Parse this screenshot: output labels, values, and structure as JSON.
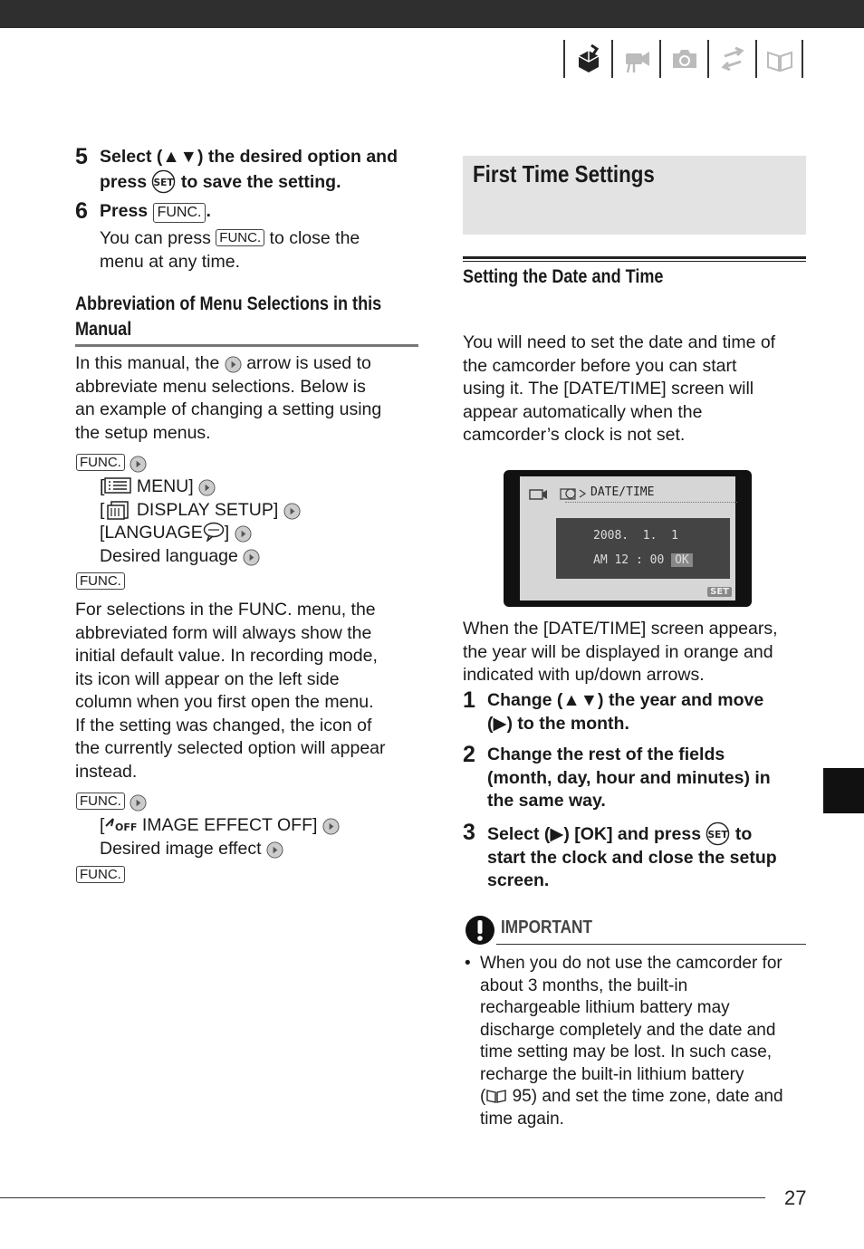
{
  "page": {
    "number": "27"
  },
  "left": {
    "step5": {
      "num": "5",
      "line1_pre": "Select (",
      "line1_arrows": "▲▼",
      "line1_post": ") the desired option and",
      "line2_pre": "press",
      "line2_post": "to save the setting."
    },
    "step6": {
      "num": "6",
      "label": "Press",
      "key": "FUNC.",
      "period": ".",
      "note_pre": "You can press",
      "note_key": "FUNC.",
      "note_post": "to close the",
      "note_line2": "menu at any time."
    },
    "abbrev": {
      "title_line1": "Abbreviation of Menu Selections in this",
      "title_line2": "Manual",
      "para1_l1_pre": "In this manual, the",
      "para1_l1_post": "arrow is used to",
      "para1_l2": "abbreviate menu selections. Below is",
      "para1_l3": "an example of changing a setting using",
      "para1_l4": "the setup menus.",
      "ex1_key1": "FUNC.",
      "ex1_menu": "MENU]",
      "ex1_display": "DISPLAY SETUP]",
      "ex1_language": "[LANGUAGE",
      "ex1_language_end": "]",
      "ex1_desired": "Desired language",
      "ex1_key2": "FUNC.",
      "para2_lines": [
        "For selections in the FUNC. menu, the",
        "abbreviated form will always show the",
        "initial default value. In recording mode,",
        "its icon will appear on the left side",
        "column when you first open the menu.",
        "If the setting was changed, the icon of",
        "the currently selected option will appear",
        "instead."
      ],
      "ex2_key1": "FUNC.",
      "ex2_effect": "IMAGE EFFECT OFF]",
      "ex2_desired": "Desired image effect",
      "ex2_key2": "FUNC."
    }
  },
  "right": {
    "section_title": "First Time Settings",
    "subsection_title": "Setting the Date and Time",
    "intro_lines": [
      "You will need to set the date and time of",
      "the camcorder before you can start",
      "using it. The [DATE/TIME] screen will",
      "appear automatically when the",
      "camcorder’s clock is not set."
    ],
    "lcd": {
      "title": "DATE/TIME",
      "date": "2008.  1.  1",
      "time_prefix": "AM 12 : 00",
      "ok": "OK",
      "set": "SET"
    },
    "after_lines": [
      "When the [DATE/TIME] screen appears,",
      "the year will be displayed in orange and",
      "indicated with up/down arrows."
    ],
    "step1": {
      "num": "1",
      "l1_pre": "Change (",
      "l1_arrows": "▲▼",
      "l1_post": ") the year and move",
      "l2": "(▶) to the month."
    },
    "step2": {
      "num": "2",
      "lines": [
        "Change the rest of the fields",
        "(month, day, hour and minutes) in",
        "the same way."
      ]
    },
    "step3": {
      "num": "3",
      "l1_pre": "Select (▶) [OK] and press",
      "l1_post": "to",
      "l2": "start the clock and close the setup",
      "l3": "screen."
    },
    "important": {
      "label": "IMPORTANT",
      "bullet": "•",
      "lines": [
        "When you do not use the camcorder for",
        "about 3 months, the built-in",
        "rechargeable lithium battery may",
        "discharge completely and the date and",
        "time setting may be lost. In such case,",
        "recharge the built-in lithium battery"
      ],
      "ref_pre": "(",
      "ref_post": " 95) and set the time zone, date and",
      "last_line": "time again."
    }
  }
}
